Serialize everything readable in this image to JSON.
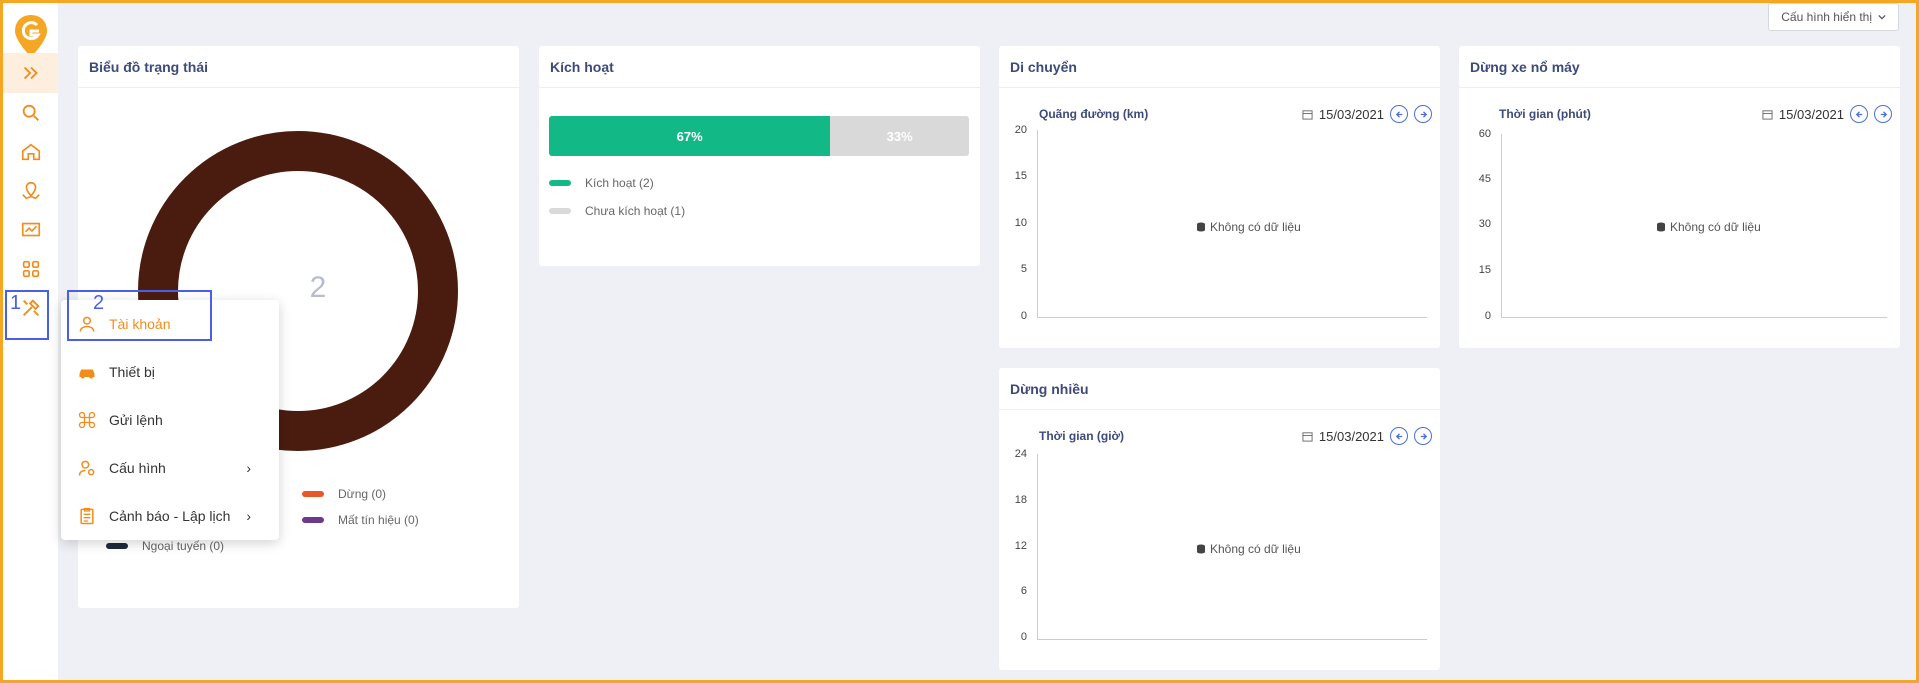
{
  "topbar": {
    "display_config_label": "Cấu hình hiển thị"
  },
  "sidebar": {
    "items": [
      {
        "name": "expand-icon"
      },
      {
        "name": "search-icon"
      },
      {
        "name": "home-icon"
      },
      {
        "name": "map-icon"
      },
      {
        "name": "chart-icon"
      },
      {
        "name": "apps-icon"
      },
      {
        "name": "tools-icon"
      }
    ]
  },
  "status_card": {
    "title": "Biểu đồ trạng thái",
    "total": "2",
    "legend": [
      {
        "label": "Dừng (0)",
        "color": "#e8572a"
      },
      {
        "label": "Mất tín hiệu (0)",
        "color": "#6b3a8f"
      },
      {
        "label": "Ngoại tuyến (0)",
        "color": "#1e2a3a"
      }
    ]
  },
  "activation_card": {
    "title": "Kích hoạt",
    "active_pct_label": "67%",
    "inactive_pct_label": "33%",
    "active_fraction": 0.67,
    "legend": [
      {
        "label": "Kích hoạt (2)",
        "color": "#12b886"
      },
      {
        "label": "Chưa kích hoạt (1)",
        "color": "#d9d9d9"
      }
    ]
  },
  "move_card": {
    "title": "Di chuyển",
    "metric": "Quãng đường (km)",
    "date": "15/03/2021",
    "y_ticks": [
      "20",
      "15",
      "10",
      "5",
      "0"
    ],
    "no_data": "Không có dữ liệu"
  },
  "idle_card": {
    "title": "Dừng xe nổ máy",
    "metric": "Thời gian (phút)",
    "date": "15/03/2021",
    "y_ticks": [
      "60",
      "45",
      "30",
      "15",
      "0"
    ],
    "no_data": "Không có dữ liệu"
  },
  "stop_card": {
    "title": "Dừng nhiều",
    "metric": "Thời gian (giờ)",
    "date": "15/03/2021",
    "y_ticks": [
      "24",
      "18",
      "12",
      "6",
      "0"
    ],
    "no_data": "Không có dữ liệu"
  },
  "menu": {
    "items": [
      {
        "label": "Tài khoản"
      },
      {
        "label": "Thiết bị"
      },
      {
        "label": "Gửi lệnh"
      },
      {
        "label": "Cấu hình"
      },
      {
        "label": "Cảnh báo - Lập lịch"
      }
    ]
  },
  "annotations": {
    "box1": "1",
    "box2": "2"
  },
  "colors": {
    "accent": "#f28c1b",
    "primary": "#3d4a7a",
    "link": "#4a6fd6"
  }
}
